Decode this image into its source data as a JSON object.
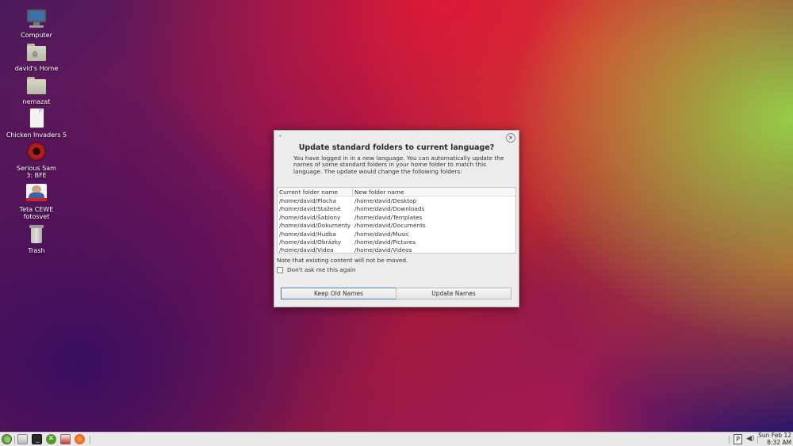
{
  "desktop": {
    "icons": [
      {
        "label": "Computer",
        "icon": "computer-icon"
      },
      {
        "label": "david's Home",
        "icon": "home-folder-icon"
      },
      {
        "label": "nemazat",
        "icon": "folder-icon"
      },
      {
        "label": "Chicken Invaders 5",
        "icon": "file-icon"
      },
      {
        "label": "Serious Sam 3: BFE",
        "icon": "game-icon"
      },
      {
        "label": "Teta CEWE fotosvet",
        "icon": "photo-app-icon"
      },
      {
        "label": "Trash",
        "icon": "trash-icon"
      }
    ]
  },
  "dialog": {
    "title": "Update standard folders to current language?",
    "message": "You have logged in in a new language. You can automatically update the names of some standard folders in your home folder to match this language. The update would change the following folders:",
    "columns": {
      "current": "Current folder name",
      "new": "New folder name"
    },
    "rows": [
      {
        "current": "/home/david/Plocha",
        "new": "/home/david/Desktop"
      },
      {
        "current": "/home/david/Stažené",
        "new": "/home/david/Downloads"
      },
      {
        "current": "/home/david/Šablony",
        "new": "/home/david/Templates"
      },
      {
        "current": "/home/david/Dokumenty",
        "new": "/home/david/Documents"
      },
      {
        "current": "/home/david/Hudba",
        "new": "/home/david/Music"
      },
      {
        "current": "/home/david/Obrázky",
        "new": "/home/david/Pictures"
      },
      {
        "current": "/home/david/Videa",
        "new": "/home/david/Videos"
      }
    ],
    "note": "Note that existing content will not be moved.",
    "checkbox_label": "Don't ask me this again",
    "checkbox_checked": false,
    "keep_button": "Keep Old Names",
    "update_button": "Update Names",
    "close_glyph": "×"
  },
  "taskbar": {
    "launchers": [
      {
        "name": "menu",
        "icon": "mint-menu-icon"
      },
      {
        "name": "files",
        "icon": "file-manager-icon"
      },
      {
        "name": "terminal",
        "icon": "terminal-icon"
      },
      {
        "name": "xbox",
        "icon": "xbox-icon"
      },
      {
        "name": "package",
        "icon": "package-installer-icon"
      },
      {
        "name": "firefox",
        "icon": "firefox-icon"
      }
    ],
    "tray_p": "P",
    "clock_date": "Sun Feb 12",
    "clock_time": "8:32 AM"
  },
  "colors": {
    "button_focus_border": "#4a7cc0",
    "taskbar_bg": "#e8e8e8",
    "dialog_bg": "#ececec"
  }
}
